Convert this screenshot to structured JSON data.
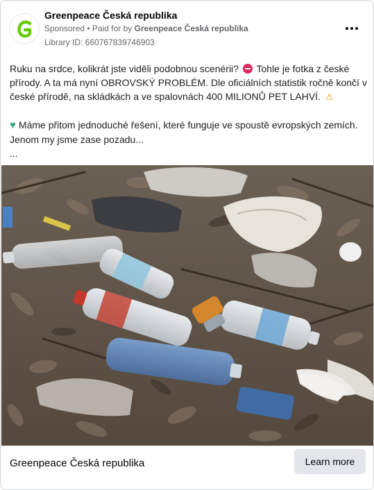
{
  "advertiser": {
    "name": "Greenpeace Česká republika",
    "sponsored_label": "Sponsored",
    "separator": " • ",
    "paid_for_prefix": "Paid for by ",
    "paid_for_name": "Greenpeace Česká republika",
    "library_id": "Library ID: 660767839746903"
  },
  "post": {
    "line1_a": "Ruku na srdce, kolikrát jste viděli podobnou scenérii?",
    "line1_b": " Tohle je fotka z české přírody. A ta má nyní OBROVSKÝ PROBLÉM. Dle oficiálních statistik ročně končí v české přírodě, na skládkách a ve spalovnách 400 MILIONŮ PET LAHVÍ.",
    "line2": "Máme přitom jednoduché řešení, které funguje ve spoustě evropských zemích. Jenom my jsme zase pozadu...",
    "ellipsis": "..."
  },
  "icons": {
    "no_entry": "no-entry-emoji-icon",
    "warning": "warning-emoji-icon",
    "heart": "green-heart-emoji-icon",
    "more": "more-options-icon",
    "logo": "greenpeace-g-logo"
  },
  "footer": {
    "title": "Greenpeace Česká republika",
    "cta_label": "Learn more"
  },
  "colors": {
    "brand_green": "#66cc00",
    "muted_text": "#65676b",
    "cta_bg": "#e4e6eb"
  }
}
